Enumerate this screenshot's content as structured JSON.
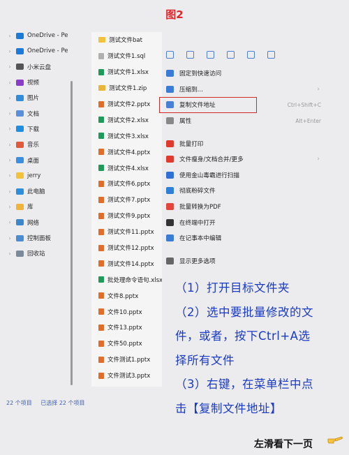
{
  "figure_title": "图2",
  "nav_items": [
    {
      "label": "OneDrive - Pe",
      "icon": "cloud-icon",
      "color": "#1c7bd8"
    },
    {
      "label": "OneDrive - Pe",
      "icon": "cloud-icon",
      "color": "#1c7bd8"
    },
    {
      "label": "小米云盘",
      "icon": "cloud-drive-icon",
      "color": "#555555"
    },
    {
      "label": "视频",
      "icon": "video-icon",
      "color": "#8a3cc9"
    },
    {
      "label": "图片",
      "icon": "picture-icon",
      "color": "#2f8ddb"
    },
    {
      "label": "文档",
      "icon": "document-icon",
      "color": "#5a8fd9"
    },
    {
      "label": "下载",
      "icon": "download-icon",
      "color": "#1f8ee0"
    },
    {
      "label": "音乐",
      "icon": "music-icon",
      "color": "#e2583b"
    },
    {
      "label": "桌面",
      "icon": "desktop-icon",
      "color": "#3c8fe0"
    },
    {
      "label": "jerry",
      "icon": "folder-icon",
      "color": "#f3c13a"
    },
    {
      "label": "此电脑",
      "icon": "computer-icon",
      "color": "#2b8fdc"
    },
    {
      "label": "库",
      "icon": "library-icon",
      "color": "#f0b43a"
    },
    {
      "label": "网络",
      "icon": "network-icon",
      "color": "#3d86cc"
    },
    {
      "label": "控制面板",
      "icon": "control-panel-icon",
      "color": "#4b8bd0"
    },
    {
      "label": "回收站",
      "icon": "recycle-bin-icon",
      "color": "#7a8a99"
    }
  ],
  "files": [
    {
      "name": "测试文件bat",
      "type": "folder",
      "color": "#f3c13a"
    },
    {
      "name": "测试文件1.sql",
      "type": "file",
      "color": "#b0b0b0"
    },
    {
      "name": "测试文件1.xlsx",
      "type": "xlsx",
      "color": "#1e9a5a"
    },
    {
      "name": "测试文件1.zip",
      "type": "zip",
      "color": "#e9b53a"
    },
    {
      "name": "测试文件2.pptx",
      "type": "pptx",
      "color": "#e26c2a"
    },
    {
      "name": "测试文件2.xlsx",
      "type": "xlsx",
      "color": "#1e9a5a"
    },
    {
      "name": "测试文件3.xlsx",
      "type": "xlsx",
      "color": "#1e9a5a"
    },
    {
      "name": "测试文件4.pptx",
      "type": "pptx",
      "color": "#e26c2a"
    },
    {
      "name": "测试文件4.xlsx",
      "type": "xlsx",
      "color": "#1e9a5a"
    },
    {
      "name": "测试文件6.pptx",
      "type": "pptx",
      "color": "#e26c2a"
    },
    {
      "name": "测试文件7.pptx",
      "type": "pptx",
      "color": "#e26c2a"
    },
    {
      "name": "测试文件9.pptx",
      "type": "pptx",
      "color": "#e26c2a"
    },
    {
      "name": "测试文件11.pptx",
      "type": "pptx",
      "color": "#e26c2a"
    },
    {
      "name": "测试文件12.pptx",
      "type": "pptx",
      "color": "#e26c2a"
    },
    {
      "name": "测试文件14.pptx",
      "type": "pptx",
      "color": "#e26c2a"
    },
    {
      "name": "批处理命令语句.xlsx",
      "type": "xlsx",
      "color": "#1e9a5a"
    },
    {
      "name": "文件8.pptx",
      "type": "pptx",
      "color": "#e26c2a"
    },
    {
      "name": "文件10.pptx",
      "type": "pptx",
      "color": "#e26c2a"
    },
    {
      "name": "文件13.pptx",
      "type": "pptx",
      "color": "#e26c2a"
    },
    {
      "name": "文件50.pptx",
      "type": "pptx",
      "color": "#e26c2a"
    },
    {
      "name": "文件测试1.pptx",
      "type": "pptx",
      "color": "#e26c2a"
    },
    {
      "name": "文件测试3.pptx",
      "type": "pptx",
      "color": "#e26c2a"
    }
  ],
  "menu": {
    "toolbar": [
      {
        "name": "cut-icon"
      },
      {
        "name": "copy-icon"
      },
      {
        "name": "paste-icon"
      },
      {
        "name": "rename-icon"
      },
      {
        "name": "share-icon"
      },
      {
        "name": "delete-icon"
      }
    ],
    "items": [
      {
        "label": "固定到快速访问",
        "icon": "pin-icon",
        "color": "#3a7bd5",
        "shortcut": "",
        "submenu": false,
        "highlight": false
      },
      {
        "label": "压缩到...",
        "icon": "archive-icon",
        "color": "#3a7bd5",
        "shortcut": "",
        "submenu": true,
        "highlight": false
      },
      {
        "label": "复制文件地址",
        "icon": "copy-path-icon",
        "color": "#4a7fd6",
        "shortcut": "Ctrl+Shift+C",
        "submenu": false,
        "highlight": true
      },
      {
        "label": "属性",
        "icon": "wrench-icon",
        "color": "#888888",
        "shortcut": "Alt+Enter",
        "submenu": false,
        "highlight": false
      },
      {
        "sep": true
      },
      {
        "label": "批量打印",
        "icon": "wps-icon",
        "color": "#e03a2f",
        "shortcut": "",
        "submenu": false,
        "highlight": false
      },
      {
        "label": "文件瘦身/文档合并/更多",
        "icon": "wps-icon",
        "color": "#e03a2f",
        "shortcut": "",
        "submenu": true,
        "highlight": false
      },
      {
        "label": "使用金山毒霸进行扫描",
        "icon": "shield-icon",
        "color": "#2f6fd6",
        "shortcut": "",
        "submenu": false,
        "highlight": false
      },
      {
        "label": "彻底粉碎文件",
        "icon": "shredder-icon",
        "color": "#2f7fd6",
        "shortcut": "",
        "submenu": false,
        "highlight": false
      },
      {
        "label": "批量转换为PDF",
        "icon": "pdf-icon",
        "color": "#e2453b",
        "shortcut": "",
        "submenu": false,
        "highlight": false
      },
      {
        "label": "在终端中打开",
        "icon": "terminal-icon",
        "color": "#333333",
        "shortcut": "",
        "submenu": false,
        "highlight": false
      },
      {
        "label": "在记事本中编辑",
        "icon": "notepad-icon",
        "color": "#3a7bd5",
        "shortcut": "",
        "submenu": false,
        "highlight": false
      },
      {
        "sep": true
      },
      {
        "label": "显示更多选项",
        "icon": "more-options-icon",
        "color": "#666666",
        "shortcut": "",
        "submenu": false,
        "highlight": false
      }
    ]
  },
  "instructions": [
    "（1）打开目标文件夹",
    "（2）选中要批量修改的文",
    "件，或者，按下Ctrl+A选",
    "择所有文件",
    "（3）右键，在菜单栏中点",
    "击【复制文件地址】"
  ],
  "status": {
    "count": "22 个项目",
    "selected": "已选择 22 个项目"
  },
  "footer": "左滑看下一页"
}
